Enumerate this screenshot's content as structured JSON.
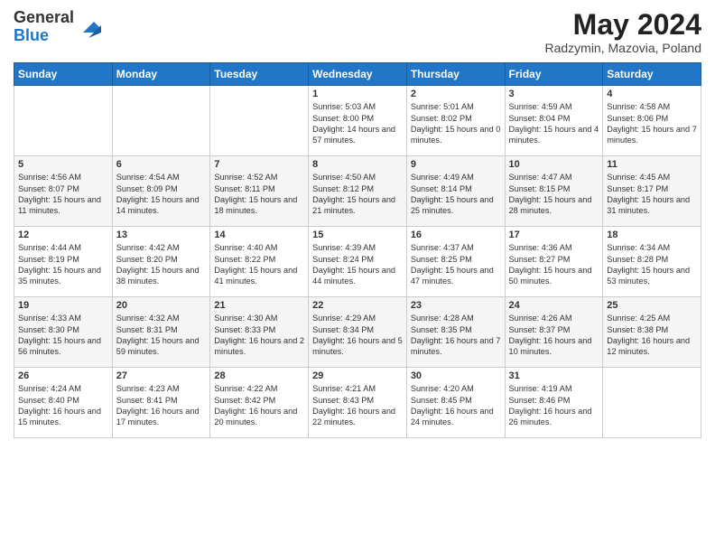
{
  "logo": {
    "general": "General",
    "blue": "Blue"
  },
  "header": {
    "month": "May 2024",
    "location": "Radzymin, Mazovia, Poland"
  },
  "days": [
    "Sunday",
    "Monday",
    "Tuesday",
    "Wednesday",
    "Thursday",
    "Friday",
    "Saturday"
  ],
  "weeks": [
    [
      {
        "day": "",
        "content": ""
      },
      {
        "day": "",
        "content": ""
      },
      {
        "day": "",
        "content": ""
      },
      {
        "day": "1",
        "content": "Sunrise: 5:03 AM\nSunset: 8:00 PM\nDaylight: 14 hours\nand 57 minutes."
      },
      {
        "day": "2",
        "content": "Sunrise: 5:01 AM\nSunset: 8:02 PM\nDaylight: 15 hours\nand 0 minutes."
      },
      {
        "day": "3",
        "content": "Sunrise: 4:59 AM\nSunset: 8:04 PM\nDaylight: 15 hours\nand 4 minutes."
      },
      {
        "day": "4",
        "content": "Sunrise: 4:58 AM\nSunset: 8:06 PM\nDaylight: 15 hours\nand 7 minutes."
      }
    ],
    [
      {
        "day": "5",
        "content": "Sunrise: 4:56 AM\nSunset: 8:07 PM\nDaylight: 15 hours\nand 11 minutes."
      },
      {
        "day": "6",
        "content": "Sunrise: 4:54 AM\nSunset: 8:09 PM\nDaylight: 15 hours\nand 14 minutes."
      },
      {
        "day": "7",
        "content": "Sunrise: 4:52 AM\nSunset: 8:11 PM\nDaylight: 15 hours\nand 18 minutes."
      },
      {
        "day": "8",
        "content": "Sunrise: 4:50 AM\nSunset: 8:12 PM\nDaylight: 15 hours\nand 21 minutes."
      },
      {
        "day": "9",
        "content": "Sunrise: 4:49 AM\nSunset: 8:14 PM\nDaylight: 15 hours\nand 25 minutes."
      },
      {
        "day": "10",
        "content": "Sunrise: 4:47 AM\nSunset: 8:15 PM\nDaylight: 15 hours\nand 28 minutes."
      },
      {
        "day": "11",
        "content": "Sunrise: 4:45 AM\nSunset: 8:17 PM\nDaylight: 15 hours\nand 31 minutes."
      }
    ],
    [
      {
        "day": "12",
        "content": "Sunrise: 4:44 AM\nSunset: 8:19 PM\nDaylight: 15 hours\nand 35 minutes."
      },
      {
        "day": "13",
        "content": "Sunrise: 4:42 AM\nSunset: 8:20 PM\nDaylight: 15 hours\nand 38 minutes."
      },
      {
        "day": "14",
        "content": "Sunrise: 4:40 AM\nSunset: 8:22 PM\nDaylight: 15 hours\nand 41 minutes."
      },
      {
        "day": "15",
        "content": "Sunrise: 4:39 AM\nSunset: 8:24 PM\nDaylight: 15 hours\nand 44 minutes."
      },
      {
        "day": "16",
        "content": "Sunrise: 4:37 AM\nSunset: 8:25 PM\nDaylight: 15 hours\nand 47 minutes."
      },
      {
        "day": "17",
        "content": "Sunrise: 4:36 AM\nSunset: 8:27 PM\nDaylight: 15 hours\nand 50 minutes."
      },
      {
        "day": "18",
        "content": "Sunrise: 4:34 AM\nSunset: 8:28 PM\nDaylight: 15 hours\nand 53 minutes."
      }
    ],
    [
      {
        "day": "19",
        "content": "Sunrise: 4:33 AM\nSunset: 8:30 PM\nDaylight: 15 hours\nand 56 minutes."
      },
      {
        "day": "20",
        "content": "Sunrise: 4:32 AM\nSunset: 8:31 PM\nDaylight: 15 hours\nand 59 minutes."
      },
      {
        "day": "21",
        "content": "Sunrise: 4:30 AM\nSunset: 8:33 PM\nDaylight: 16 hours\nand 2 minutes."
      },
      {
        "day": "22",
        "content": "Sunrise: 4:29 AM\nSunset: 8:34 PM\nDaylight: 16 hours\nand 5 minutes."
      },
      {
        "day": "23",
        "content": "Sunrise: 4:28 AM\nSunset: 8:35 PM\nDaylight: 16 hours\nand 7 minutes."
      },
      {
        "day": "24",
        "content": "Sunrise: 4:26 AM\nSunset: 8:37 PM\nDaylight: 16 hours\nand 10 minutes."
      },
      {
        "day": "25",
        "content": "Sunrise: 4:25 AM\nSunset: 8:38 PM\nDaylight: 16 hours\nand 12 minutes."
      }
    ],
    [
      {
        "day": "26",
        "content": "Sunrise: 4:24 AM\nSunset: 8:40 PM\nDaylight: 16 hours\nand 15 minutes."
      },
      {
        "day": "27",
        "content": "Sunrise: 4:23 AM\nSunset: 8:41 PM\nDaylight: 16 hours\nand 17 minutes."
      },
      {
        "day": "28",
        "content": "Sunrise: 4:22 AM\nSunset: 8:42 PM\nDaylight: 16 hours\nand 20 minutes."
      },
      {
        "day": "29",
        "content": "Sunrise: 4:21 AM\nSunset: 8:43 PM\nDaylight: 16 hours\nand 22 minutes."
      },
      {
        "day": "30",
        "content": "Sunrise: 4:20 AM\nSunset: 8:45 PM\nDaylight: 16 hours\nand 24 minutes."
      },
      {
        "day": "31",
        "content": "Sunrise: 4:19 AM\nSunset: 8:46 PM\nDaylight: 16 hours\nand 26 minutes."
      },
      {
        "day": "",
        "content": ""
      }
    ]
  ]
}
